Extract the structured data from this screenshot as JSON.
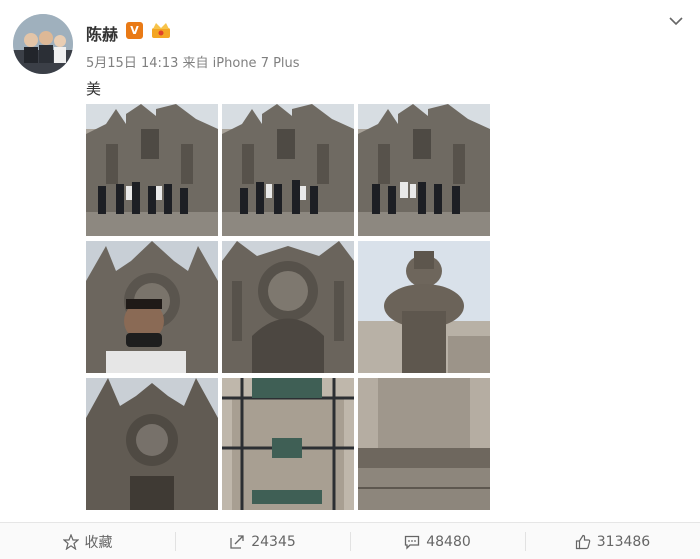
{
  "user": {
    "name": "陈赫",
    "verified_badge": "V",
    "verified_color": "#e97a16"
  },
  "post": {
    "meta": "5月15日 14:13 来自 iPhone 7 Plus",
    "text": "美",
    "images": [
      {
        "name": "group-jump-photo-1",
        "icon": "cathedral-group-photo"
      },
      {
        "name": "group-jump-photo-2",
        "icon": "cathedral-group-photo"
      },
      {
        "name": "group-jump-photo-3",
        "icon": "cathedral-group-photo"
      },
      {
        "name": "selfie-photo",
        "icon": "cathedral-selfie-photo"
      },
      {
        "name": "facade-photo",
        "icon": "cathedral-facade-photo"
      },
      {
        "name": "statue-photo",
        "icon": "statue-photo"
      },
      {
        "name": "cathedral-photo",
        "icon": "cathedral-photo"
      },
      {
        "name": "gate-photo",
        "icon": "gate-photo"
      },
      {
        "name": "stone-photo",
        "icon": "stone-photo"
      }
    ]
  },
  "actions": {
    "favorite_label": "收藏",
    "repost_count": "24345",
    "comment_count": "48480",
    "like_count": "313486"
  },
  "icons": {
    "favorite": "star-icon",
    "repost": "repost-icon",
    "comment": "comment-icon",
    "like": "thumbs-up-icon",
    "menu": "chevron-down-icon",
    "crown": "crown-icon"
  }
}
